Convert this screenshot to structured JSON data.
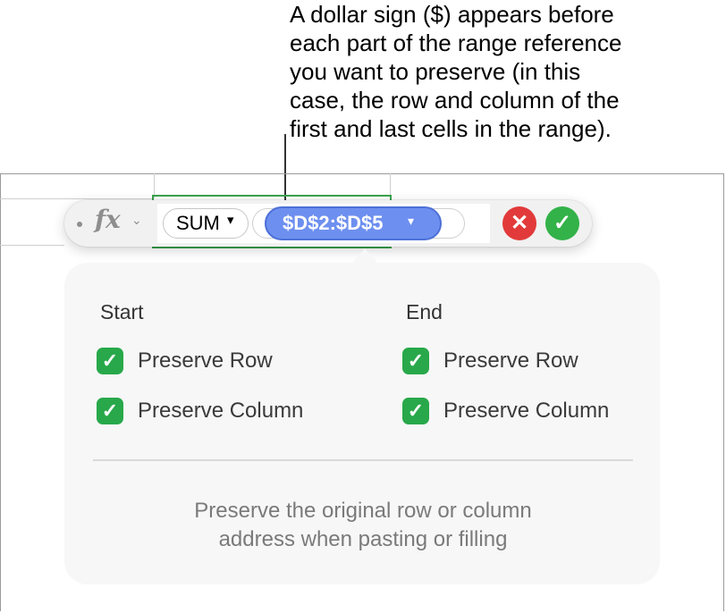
{
  "callout": {
    "lines": [
      "A dollar sign ($) appears before",
      "each part of the range reference",
      "you want to preserve (in this",
      "case, the row and column of the",
      "first and last cells in the range)."
    ]
  },
  "formula_bar": {
    "fx_symbol": "fx",
    "fx_chevron": "⌄",
    "function_name": "SUM",
    "function_arrow": "▾",
    "range_reference": "$D$2:$D$5",
    "range_arrow": "▾",
    "cancel_symbol": "✕",
    "confirm_symbol": "✓"
  },
  "popover": {
    "start": {
      "heading": "Start",
      "preserve_row": {
        "label": "Preserve Row",
        "checked": true
      },
      "preserve_column": {
        "label": "Preserve Column",
        "checked": true
      }
    },
    "end": {
      "heading": "End",
      "preserve_row": {
        "label": "Preserve Row",
        "checked": true
      },
      "preserve_column": {
        "label": "Preserve Column",
        "checked": true
      }
    },
    "check_glyph": "✓",
    "hint_lines": [
      "Preserve the original row or column",
      "address when pasting or filling"
    ]
  },
  "colors": {
    "range_pill": "#6d8fef",
    "checkbox": "#28a84a",
    "cancel": "#e23a3a",
    "confirm": "#33b249",
    "cell_outline": "#3aa34d"
  }
}
